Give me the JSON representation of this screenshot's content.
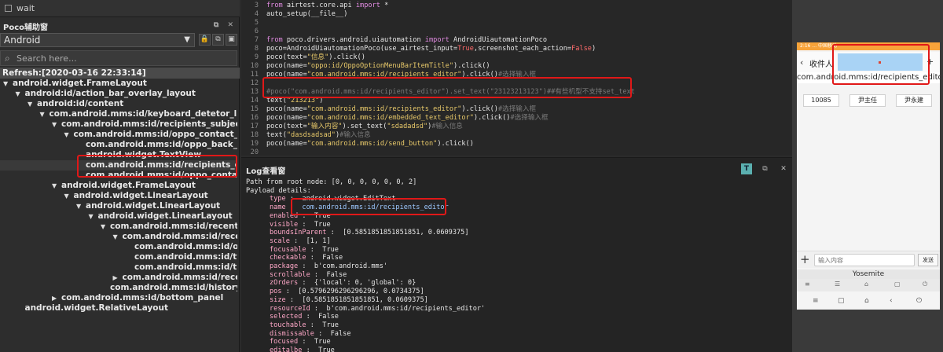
{
  "topstrip": {
    "label": "wait"
  },
  "poco": {
    "title": "Poco辅助窗",
    "platform": "Android",
    "search_placeholder": "Search here...",
    "refresh": "Refresh:[2020-03-16 22:33:14]",
    "tree": [
      {
        "label": "android.widget.FrameLayout",
        "depth": 0,
        "twisty": "▼"
      },
      {
        "label": "android:id/action_bar_overlay_layout",
        "depth": 1,
        "twisty": "▼"
      },
      {
        "label": "android:id/content",
        "depth": 2,
        "twisty": "▼"
      },
      {
        "label": "com.android.mms:id/keyboard_detetor_linearla...",
        "depth": 3,
        "twisty": "▼"
      },
      {
        "label": "com.android.mms:id/recipients_subject_linear",
        "depth": 4,
        "twisty": "▼"
      },
      {
        "label": "com.android.mms:id/oppo_contact_editor",
        "depth": 5,
        "twisty": "▼"
      },
      {
        "label": "com.android.mms:id/oppo_back_bt",
        "depth": 6,
        "twisty": ""
      },
      {
        "label": "android.widget.TextView",
        "depth": 6,
        "twisty": ""
      },
      {
        "label": "com.android.mms:id/recipients_editor",
        "depth": 6,
        "twisty": "",
        "selected": true
      },
      {
        "label": "com.android.mms:id/oppo_contact_bt",
        "depth": 6,
        "twisty": ""
      },
      {
        "label": "android.widget.FrameLayout",
        "depth": 4,
        "twisty": "▼"
      },
      {
        "label": "android.widget.LinearLayout",
        "depth": 5,
        "twisty": "▼"
      },
      {
        "label": "android.widget.LinearLayout",
        "depth": 6,
        "twisty": "▼"
      },
      {
        "label": "android.widget.LinearLayout",
        "depth": 7,
        "twisty": "▼"
      },
      {
        "label": "com.android.mms:id/recent_re...",
        "depth": 8,
        "twisty": "▼"
      },
      {
        "label": "com.android.mms:id/recen...",
        "depth": 9,
        "twisty": "▼"
      },
      {
        "label": "com.android.mms:id/one",
        "depth": 10,
        "twisty": ""
      },
      {
        "label": "com.android.mms:id/two",
        "depth": 10,
        "twisty": ""
      },
      {
        "label": "com.android.mms:id/thr...",
        "depth": 10,
        "twisty": ""
      },
      {
        "label": "com.android.mms:id/recen...",
        "depth": 9,
        "twisty": "▶"
      },
      {
        "label": "com.android.mms:id/history",
        "depth": 8,
        "twisty": ""
      },
      {
        "label": "com.android.mms:id/bottom_panel",
        "depth": 4,
        "twisty": "▶"
      },
      {
        "label": "android.widget.RelativeLayout",
        "depth": 1,
        "twisty": ""
      }
    ]
  },
  "code": {
    "lines": [
      {
        "n": "3",
        "parts": [
          [
            "kw",
            "from "
          ],
          [
            "txt",
            "airtest.core.api "
          ],
          [
            "kw",
            "import "
          ],
          [
            "txt",
            "*"
          ]
        ]
      },
      {
        "n": "4",
        "parts": [
          [
            "txt",
            "auto_setup(__file__)"
          ]
        ]
      },
      {
        "n": "5",
        "parts": []
      },
      {
        "n": "6",
        "parts": []
      },
      {
        "n": "7",
        "parts": [
          [
            "kw",
            "from "
          ],
          [
            "txt",
            "poco.drivers.android.uiautomation "
          ],
          [
            "kw",
            "import "
          ],
          [
            "txt",
            "AndroidUiautomationPoco"
          ]
        ]
      },
      {
        "n": "8",
        "parts": [
          [
            "txt",
            "poco=AndroidUiautomationPoco(use_airtest_input="
          ],
          [
            "kw2",
            "True"
          ],
          [
            "txt",
            ",screenshot_each_action="
          ],
          [
            "kw2",
            "False"
          ],
          [
            "txt",
            ")"
          ]
        ]
      },
      {
        "n": "9",
        "parts": [
          [
            "txt",
            "poco(text="
          ],
          [
            "str",
            "\"信息\""
          ],
          [
            "txt",
            ").click()"
          ]
        ]
      },
      {
        "n": "10",
        "parts": [
          [
            "txt",
            "poco(name="
          ],
          [
            "str",
            "\"oppo:id/OppoOptionMenuBarItemTitle\""
          ],
          [
            "txt",
            ").click()"
          ]
        ]
      },
      {
        "n": "11",
        "parts": [
          [
            "txt",
            "poco(name="
          ],
          [
            "str",
            "\"com.android.mms:id/recipients_editor\""
          ],
          [
            "txt",
            ").click()"
          ],
          [
            "cmt",
            "#选择输入框"
          ]
        ]
      },
      {
        "n": "12",
        "parts": []
      },
      {
        "n": "13",
        "parts": [
          [
            "cmt",
            "#poco(\"com.android.mms:id/recipients_editor\").set_text(\"23123213123\")##有些机型不支持set_text"
          ]
        ]
      },
      {
        "n": "14",
        "parts": [
          [
            "txt",
            "text("
          ],
          [
            "str",
            "\"213213\""
          ],
          [
            "txt",
            ")"
          ]
        ]
      },
      {
        "n": "15",
        "parts": [
          [
            "txt",
            "poco(name="
          ],
          [
            "str",
            "\"com.android.mms:id/recipients_editor\""
          ],
          [
            "txt",
            ").click()"
          ],
          [
            "cmt",
            "#选择输入框"
          ]
        ]
      },
      {
        "n": "16",
        "parts": [
          [
            "txt",
            "poco(name="
          ],
          [
            "str",
            "\"com.android.mms:id/embedded_text_editor\""
          ],
          [
            "txt",
            ").click()"
          ],
          [
            "cmt",
            "#选择输入框"
          ]
        ]
      },
      {
        "n": "17",
        "parts": [
          [
            "txt",
            "poco(text="
          ],
          [
            "str",
            "\"输入内容\""
          ],
          [
            "txt",
            ").set_text("
          ],
          [
            "str",
            "\"sdadadsd\""
          ],
          [
            "txt",
            ")"
          ],
          [
            "cmt",
            "#输入信息"
          ]
        ]
      },
      {
        "n": "18",
        "parts": [
          [
            "txt",
            "text("
          ],
          [
            "str",
            "\"dasdsadsad\""
          ],
          [
            "txt",
            ")"
          ],
          [
            "cmt",
            "#输入信息"
          ]
        ]
      },
      {
        "n": "19",
        "parts": [
          [
            "txt",
            "poco(name="
          ],
          [
            "str",
            "\"com.android.mms:id/send_button\""
          ],
          [
            "txt",
            ").click()"
          ]
        ]
      },
      {
        "n": "20",
        "parts": []
      }
    ]
  },
  "log": {
    "title": "Log查看窗",
    "buttons": [
      "T",
      "⧉",
      "✕"
    ],
    "lines": [
      {
        "k": "",
        "v": "Path from root node: [0, 0, 0, 0, 0, 0, 2]",
        "indent": 0
      },
      {
        "k": "",
        "v": "Payload details:",
        "indent": 0
      },
      {
        "k": "type",
        "v": "android.widget.EditText",
        "indent": 1
      },
      {
        "k": "name",
        "v": "com.android.mms:id/recipients_editor",
        "indent": 1
      },
      {
        "k": "enabled",
        "v": "True",
        "indent": 1
      },
      {
        "k": "visible",
        "v": "True",
        "indent": 1
      },
      {
        "k": "boundsInParent",
        "v": "[0.5851851851851851, 0.0609375]",
        "indent": 1
      },
      {
        "k": "scale",
        "v": "[1, 1]",
        "indent": 1
      },
      {
        "k": "focusable",
        "v": "True",
        "indent": 1
      },
      {
        "k": "checkable",
        "v": "False",
        "indent": 1
      },
      {
        "k": "package",
        "v": "b'com.android.mms'",
        "indent": 1
      },
      {
        "k": "scrollable",
        "v": "False",
        "indent": 1
      },
      {
        "k": "zOrders",
        "v": "{'local': 0, 'global': 0}",
        "indent": 1
      },
      {
        "k": "pos",
        "v": "[0.5796296296296296, 0.0734375]",
        "indent": 1
      },
      {
        "k": "size",
        "v": "[0.5851851851851851, 0.0609375]",
        "indent": 1
      },
      {
        "k": "resourceId",
        "v": "b'com.android.mms:id/recipients_editor'",
        "indent": 1
      },
      {
        "k": "selected",
        "v": "False",
        "indent": 1
      },
      {
        "k": "touchable",
        "v": "True",
        "indent": 1
      },
      {
        "k": "dismissable",
        "v": "False",
        "indent": 1
      },
      {
        "k": "focused",
        "v": "True",
        "indent": 1
      },
      {
        "k": "editalbe",
        "v": "True",
        "indent": 1
      }
    ]
  },
  "device": {
    "status_text": "2:16 ... 中国移动",
    "header_title": "收件人",
    "back_icon": "‹",
    "add_icon": "+",
    "tooltip": "com.android.mms:id/recipients_editor",
    "chips": [
      "10085",
      "尹主任",
      "尹永建"
    ],
    "input_placeholder": "输入内容",
    "send_label": "发送",
    "ime_name": "Yosemite",
    "ime_icons": [
      "≡",
      "☰",
      "⌂",
      "▢",
      "⏻"
    ],
    "nav_icons": [
      "≡",
      "▢",
      "⌂",
      "‹",
      "⏻"
    ]
  },
  "colors": {
    "highlight": "#e01818",
    "phone_edit": "#a9d3f5",
    "status_bar": "#f7a33a"
  }
}
